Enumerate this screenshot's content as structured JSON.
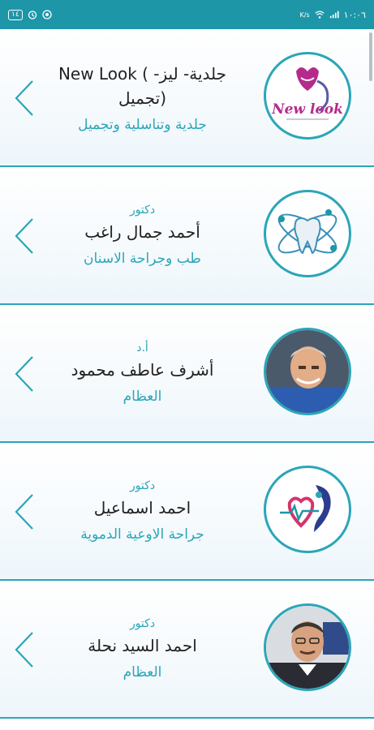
{
  "status_bar": {
    "time": "١٠:٠٦",
    "battery": "١٤",
    "network_speed": "K/s",
    "icons": [
      "battery-icon",
      "alarm-icon",
      "whatsapp-icon",
      "wifi-icon",
      "signal-icon"
    ]
  },
  "doctors": [
    {
      "title": "",
      "name": "جلدية- ليز- ) New Look (تجميل",
      "specialty": "جلدية وتناسلية وتجميل",
      "avatar": "newlook-logo",
      "logo_text": "New look"
    },
    {
      "title": "دكتور",
      "name": "أحمد جمال راغب",
      "specialty": "طب وجراحة الاسنان",
      "avatar": "tooth-atom-icon"
    },
    {
      "title": "أ.د",
      "name": "أشرف عاطف محمود",
      "specialty": "العظام",
      "avatar": "doctor-photo"
    },
    {
      "title": "دكتور",
      "name": "احمد اسماعيل",
      "specialty": "جراحة الاوعية الدموية",
      "avatar": "vascular-logo"
    },
    {
      "title": "دكتور",
      "name": "احمد السيد نحلة",
      "specialty": "العظام",
      "avatar": "doctor-photo"
    }
  ],
  "colors": {
    "accent": "#2aa6b8",
    "status_bar": "#1d96a8",
    "name_text": "#222222"
  }
}
